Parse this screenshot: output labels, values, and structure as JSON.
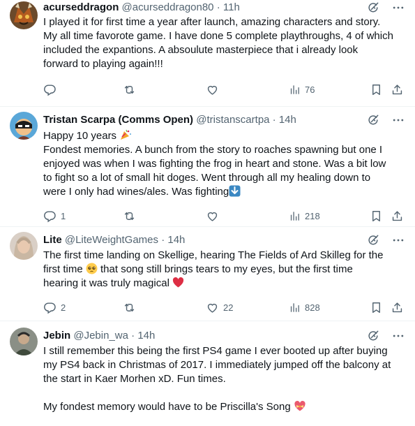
{
  "tweets": [
    {
      "name": "acurseddragon",
      "handle": "@acurseddragon80",
      "sep": " · ",
      "time": "11h",
      "avatar_icon": "dragon-avatar",
      "lines": [
        "I played it for first time a year after launch, amazing characters and story.",
        "My all time favorote game. I have done 5 complete playthroughs, 4 of which",
        "included the expantions.  A absoulute masterpiece that i already look",
        "forward to playing again!!!"
      ],
      "reply_count": "",
      "retweet_count": "",
      "like_count": "",
      "views": "76"
    },
    {
      "name": "Tristan Scarpa (Comms Open)",
      "handle": "@tristanscartpa",
      "sep": " · ",
      "time": "14h",
      "avatar_icon": "masked-character-avatar",
      "lines": [
        "Happy 10 years",
        "Fondest memories. A bunch from the story to roaches spawning but one I",
        "enjoyed was when I was fighting the frog in heart and stone. Was a bit low",
        "to fight so a lot of small hit doges. Went through all my healing down to",
        "were I only had wines/ales. Was fighting"
      ],
      "emoji_line1": "party-popper-emoji",
      "emoji_last": "down-arrow-emoji",
      "reply_count": "1",
      "retweet_count": "",
      "like_count": "",
      "views": "218"
    },
    {
      "name": "Lite",
      "handle": "@LiteWeightGames",
      "sep": " · ",
      "time": "14h",
      "avatar_icon": "woman-avatar",
      "lines": [
        "The first time landing on Skellige, hearing The Fields of Ard Skilleg for the",
        "first time",
        " that song still brings tears to my eyes, but the first time",
        "hearing it was truly magical"
      ],
      "emoji_mid": "pleading-face-emoji",
      "emoji_last": "red-heart-emoji",
      "reply_count": "2",
      "retweet_count": "",
      "like_count": "22",
      "views": "828"
    },
    {
      "name": "Jebin",
      "handle": "@Jebin_wa",
      "sep": " · ",
      "time": "14h",
      "avatar_icon": "person-avatar",
      "lines": [
        "I still remember this being the first PS4 game I ever booted up after buying",
        "my PS4 back in Christmas of 2017. I immediately jumped off the balcony at",
        "the start in Kaer Morhen xD. Fun times.",
        "",
        "My fondest memory would have to be Priscilla's Song"
      ],
      "emoji_last": "heart-with-ribbon-emoji"
    }
  ],
  "colors": {
    "text": "#0f1419",
    "secondary": "#536471",
    "divider": "#eff3f4",
    "heart_red": "#e0245e"
  }
}
